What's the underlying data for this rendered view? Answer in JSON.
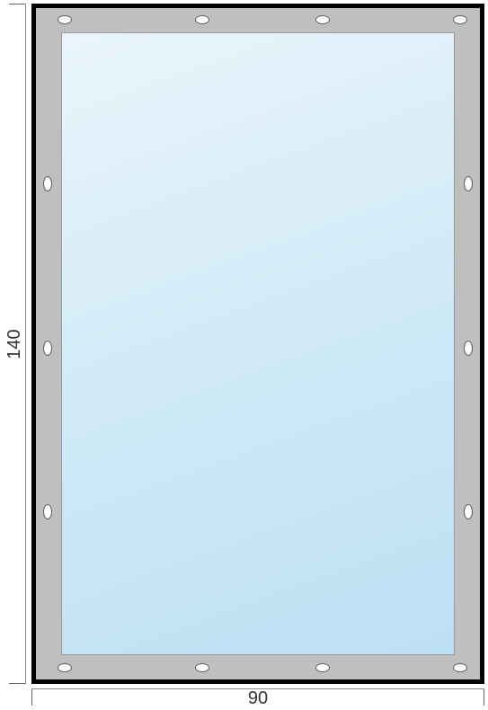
{
  "dimensions": {
    "height_label": "140",
    "width_label": "90"
  },
  "frame": {
    "eyelets": {
      "top": [
        0.04,
        0.36,
        0.64,
        0.96
      ],
      "bottom": [
        0.04,
        0.36,
        0.64,
        0.96
      ],
      "left": [
        0.25,
        0.5,
        0.75
      ],
      "right": [
        0.25,
        0.5,
        0.75
      ]
    }
  }
}
